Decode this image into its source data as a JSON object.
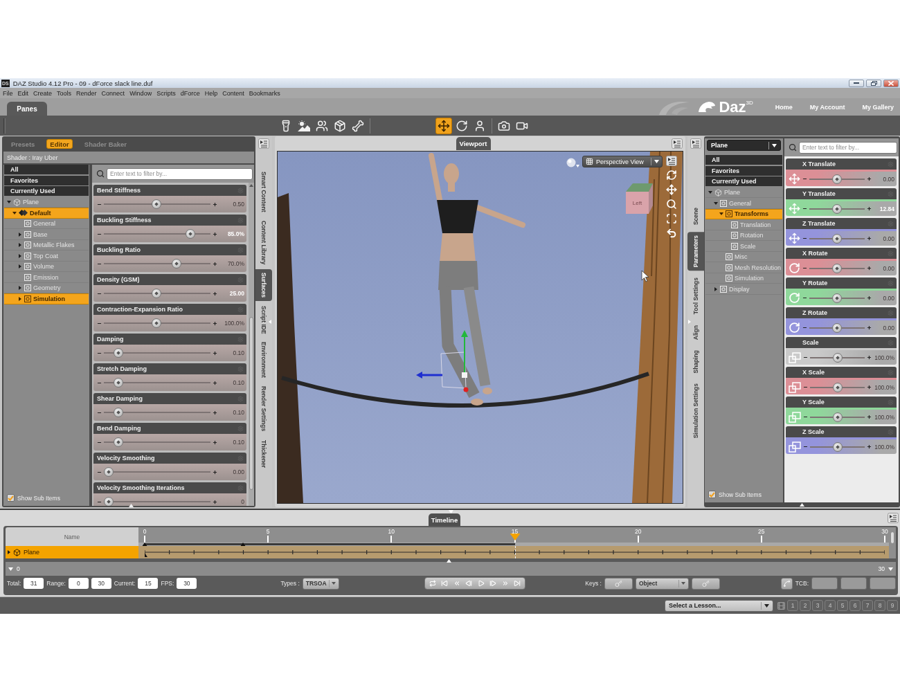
{
  "window": {
    "icon": "DS",
    "title": "DAZ Studio 4.12 Pro - 09 - dForce slack line.duf"
  },
  "menu": [
    "File",
    "Edit",
    "Create",
    "Tools",
    "Render",
    "Connect",
    "Window",
    "Scripts",
    "dForce",
    "Help",
    "Content",
    "Bookmarks"
  ],
  "layout_tabs": [
    {
      "label": "Panes",
      "selected": true
    }
  ],
  "header": {
    "logo": "Daz$^{3D}$",
    "links": [
      "Home",
      "My Account",
      "My Gallery"
    ]
  },
  "toolbar": [
    {
      "items": [
        {
          "kind": "spotlight",
          "selected": false
        },
        {
          "kind": "sun",
          "selected": false
        },
        {
          "kind": "figures",
          "selected": false
        },
        {
          "kind": "transfer",
          "selected": false
        },
        {
          "kind": "rigging",
          "selected": false
        }
      ]
    },
    {
      "items": [
        {
          "kind": "universal",
          "selected": true
        },
        {
          "kind": "rotate",
          "selected": false
        },
        {
          "kind": "pose",
          "selected": false
        }
      ]
    },
    {
      "items": [
        {
          "kind": "camera",
          "selected": false
        },
        {
          "kind": "camera-aim",
          "selected": false
        }
      ]
    }
  ],
  "surfaces": {
    "tabs": [
      {
        "label": "Presets",
        "selected": false
      },
      {
        "label": "Editor",
        "selected": true
      },
      {
        "label": "Shader Baker",
        "selected": false
      }
    ],
    "shader": "Shader : Iray Uber",
    "filters": [
      "All",
      "Favorites",
      "Currently Used"
    ],
    "tree": [
      {
        "label": "Plane",
        "kind": "figure",
        "expanded": true,
        "selected": false,
        "children": [
          {
            "label": "Default",
            "kind": "material",
            "expanded": true,
            "selected": true,
            "children": [
              {
                "label": "General",
                "kind": "group",
                "selected": false
              },
              {
                "label": "Base",
                "kind": "group",
                "expanded": false,
                "selected": false
              },
              {
                "label": "Metallic Flakes",
                "kind": "group",
                "expanded": false,
                "selected": false
              },
              {
                "label": "Top Coat",
                "kind": "group",
                "expanded": false,
                "selected": false
              },
              {
                "label": "Volume",
                "kind": "group",
                "expanded": false,
                "selected": false
              },
              {
                "label": "Emission",
                "kind": "group",
                "selected": false
              },
              {
                "label": "Geometry",
                "kind": "group",
                "expanded": false,
                "selected": false
              },
              {
                "label": "Simulation",
                "kind": "group",
                "expanded": false,
                "selected": true
              }
            ]
          }
        ]
      }
    ],
    "search": {
      "placeholder": "Enter text to filter by..."
    },
    "properties": [
      {
        "label": "Bend Stiffness",
        "level": 0.49,
        "value": "0.50",
        "modified": false
      },
      {
        "label": "Buckling Stiffness",
        "level": 0.84,
        "value": "85.0%",
        "modified": true
      },
      {
        "label": "Buckling Ratio",
        "level": 0.7,
        "value": "70.0%",
        "modified": false
      },
      {
        "label": "Density (GSM)",
        "level": 0.49,
        "value": "25.00",
        "modified": true
      },
      {
        "label": "Contraction-Expansion Ratio",
        "level": 0.49,
        "value": "100.0%",
        "modified": false
      },
      {
        "label": "Damping",
        "level": 0.1,
        "value": "0.10",
        "modified": false
      },
      {
        "label": "Stretch Damping",
        "level": 0.1,
        "value": "0.10",
        "modified": false
      },
      {
        "label": "Shear Damping",
        "level": 0.1,
        "value": "0.10",
        "modified": false
      },
      {
        "label": "Bend Damping",
        "level": 0.1,
        "value": "0.10",
        "modified": false
      },
      {
        "label": "Velocity Smoothing",
        "level": 0,
        "value": "0.00",
        "modified": false
      },
      {
        "label": "Velocity Smoothing Iterations",
        "level": 0,
        "value": "0",
        "modified": false
      }
    ],
    "side_tabs": [
      {
        "label": "Smart Content",
        "selected": false
      },
      {
        "label": "Content Library",
        "selected": false
      },
      {
        "label": "Surfaces",
        "selected": true
      },
      {
        "label": "Script IDE",
        "selected": false
      },
      {
        "label": "Environment",
        "selected": false
      },
      {
        "label": "Render Settings",
        "selected": false
      },
      {
        "label": "Thickener",
        "selected": false
      }
    ],
    "show_sub_items": {
      "label": "Show Sub Items",
      "checked": true
    }
  },
  "viewport": {
    "tab": "Viewport",
    "view": "Perspective View",
    "cube_face": "Left"
  },
  "parameters": {
    "side_tabs": [
      {
        "label": "Scene",
        "selected": false
      },
      {
        "label": "Parameters",
        "selected": true
      },
      {
        "label": "Tool Settings",
        "selected": false
      },
      {
        "label": "Align",
        "selected": false
      },
      {
        "label": "Shaping",
        "selected": false
      },
      {
        "label": "Simulation Settings",
        "selected": false
      }
    ],
    "node": "Plane",
    "filters": [
      "All",
      "Favorites",
      "Currently Used"
    ],
    "tree": [
      {
        "label": "Plane",
        "kind": "figure",
        "expanded": true,
        "selected": false,
        "children": [
          {
            "label": "General",
            "kind": "group",
            "expanded": true,
            "selected": false,
            "children": [
              {
                "label": "Transforms",
                "kind": "group",
                "expanded": true,
                "selected": true,
                "children": [
                  {
                    "label": "Translation",
                    "kind": "group",
                    "selected": false
                  },
                  {
                    "label": "Rotation",
                    "kind": "group",
                    "selected": false
                  },
                  {
                    "label": "Scale",
                    "kind": "group",
                    "selected": false
                  }
                ]
              },
              {
                "label": "Misc",
                "kind": "group",
                "selected": false
              },
              {
                "label": "Mesh Resolution",
                "kind": "group",
                "selected": false
              },
              {
                "label": "Simulation",
                "kind": "group",
                "selected": false
              }
            ]
          },
          {
            "label": "Display",
            "kind": "group",
            "expanded": false,
            "selected": false
          }
        ]
      }
    ],
    "search": {
      "placeholder": "Enter text to filter by..."
    },
    "properties": [
      {
        "label": "X Translate",
        "kind": "translate",
        "color": "#dc8f96",
        "level": 0.5,
        "value": "0.00",
        "modified": false
      },
      {
        "label": "Y Translate",
        "kind": "translate",
        "color": "#8fd89b",
        "level": 0.5,
        "value": "12.84",
        "modified": true
      },
      {
        "label": "Z Translate",
        "kind": "translate",
        "color": "#9494dc",
        "level": 0.5,
        "value": "0.00",
        "modified": false
      },
      {
        "label": "X Rotate",
        "kind": "rotate",
        "color": "#dc8f96",
        "level": 0.5,
        "value": "0.00",
        "modified": false
      },
      {
        "label": "Y Rotate",
        "kind": "rotate",
        "color": "#8fd89b",
        "level": 0.5,
        "value": "0.00",
        "modified": false
      },
      {
        "label": "Z Rotate",
        "kind": "rotate",
        "color": "#9494dc",
        "level": 0.5,
        "value": "0.00",
        "modified": false
      },
      {
        "label": "Scale",
        "kind": "scale",
        "color": "#cacaca",
        "level": 0.5,
        "value": "100.0%",
        "modified": false
      },
      {
        "label": "X Scale",
        "kind": "scale",
        "color": "#dc8f96",
        "level": 0.5,
        "value": "100.0%",
        "modified": false
      },
      {
        "label": "Y Scale",
        "kind": "scale",
        "color": "#8fd89b",
        "level": 0.5,
        "value": "100.0%",
        "modified": false
      },
      {
        "label": "Z Scale",
        "kind": "scale",
        "color": "#9494dc",
        "level": 0.5,
        "value": "100.0%",
        "modified": false
      }
    ],
    "show_sub_items": {
      "label": "Show Sub Items",
      "checked": true
    }
  },
  "timeline": {
    "tab": "Timeline",
    "name_header": "Name",
    "ticks": [
      "0",
      "5",
      "10",
      "15",
      "20",
      "25",
      "30"
    ],
    "playhead": {
      "level": 0.5
    },
    "key_markers": [
      {
        "level": 0
      },
      {
        "level": 0.133
      }
    ],
    "rows": [
      {
        "label": "Plane",
        "expanded": false,
        "selected": true
      }
    ],
    "range_start": "0",
    "range_end": "30",
    "frame_fields": [
      {
        "label": "Total:",
        "values": [
          "31"
        ]
      },
      {
        "label": "Range:",
        "values": [
          "0",
          "30"
        ]
      },
      {
        "label": "Current:",
        "values": [
          "15"
        ]
      },
      {
        "label": "FPS:",
        "values": [
          "30"
        ]
      }
    ],
    "types": {
      "label": "Types :",
      "value": "TRSOA"
    },
    "playback": [
      {
        "kind": "loop"
      },
      {
        "kind": "first"
      },
      {
        "kind": "prev-key"
      },
      {
        "kind": "prev"
      },
      {
        "kind": "play"
      },
      {
        "kind": "next"
      },
      {
        "kind": "next-key"
      },
      {
        "kind": "last"
      }
    ],
    "keys": {
      "label": "Keys :",
      "mode": "Object"
    },
    "tcb": {
      "label": "TCB:"
    }
  },
  "status_bar": {
    "lesson": "Select a Lesson...",
    "pages": [
      "1",
      "2",
      "3",
      "4",
      "5",
      "6",
      "7",
      "8",
      "9"
    ]
  }
}
